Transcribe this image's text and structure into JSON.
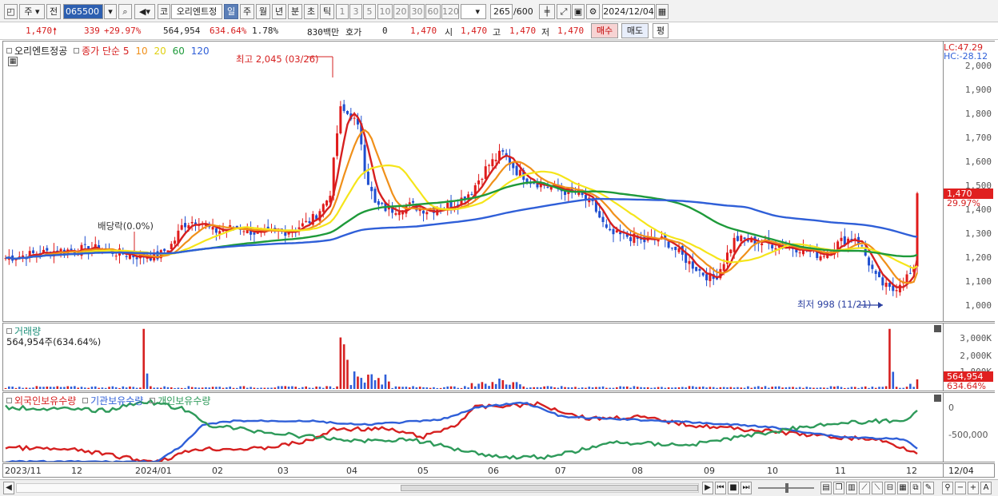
{
  "toolbar": {
    "period_type": "주",
    "prev_label": "전",
    "code": "065500",
    "market_label": "코",
    "stock_name": "오리엔트정",
    "timeframes": [
      "일",
      "주",
      "월",
      "년",
      "분",
      "초",
      "틱"
    ],
    "selected_timeframe": "일",
    "intervals": [
      "1",
      "3",
      "5",
      "10",
      "20",
      "30",
      "60",
      "120"
    ],
    "count": "265",
    "count_max": "/600",
    "date": "2024/12/04"
  },
  "quote": {
    "price": "1,470",
    "change": "339",
    "change_pct": "+29.97%",
    "volume": "564,954",
    "volume_pct": "634.64%",
    "turnover_pct": "1.78%",
    "amount": "830백만",
    "bid_label": "호가",
    "bid_value": "0",
    "bid_price": "1,470",
    "open_label": "시",
    "open": "1,470",
    "high_label": "고",
    "high": "1,470",
    "low_label": "저",
    "low": "1,470",
    "buy_label": "매수",
    "sell_label": "매도",
    "eval_label": "평"
  },
  "price_panel": {
    "name": "오리엔트정공",
    "ma_label": "종가 단순",
    "ma_periods": [
      "5",
      "10",
      "20",
      "60",
      "120"
    ],
    "ma_colors": [
      "#d62020",
      "#f0901a",
      "#f2e21a",
      "#1e9a3a",
      "#2f5fd8"
    ],
    "lc": "LC:47.29",
    "hc": "HC:-28.12",
    "high_annotation": "최고 2,045 (03/26)",
    "low_annotation": "최저 998 (11/21)",
    "dividend_annotation": "배당락(0.0%)",
    "current_price": "1,470",
    "current_pct": "29.97%",
    "y_ticks": [
      "2,000",
      "1,900",
      "1,800",
      "1,700",
      "1,600",
      "1,500",
      "1,400",
      "1,300",
      "1,200",
      "1,100",
      "1,000"
    ]
  },
  "volume_panel": {
    "title": "거래량",
    "current": "564,954주(634.64%)",
    "y_ticks": [
      "3,000K",
      "2,000K",
      "1,000K"
    ],
    "current_value": "564,954",
    "current_pct": "634.64%"
  },
  "holding_panel": {
    "legend": [
      "외국인보유수량",
      "기관보유수량",
      "개인보유수량"
    ],
    "colors": [
      "#d62020",
      "#2f5fd8",
      "#2e9a5a"
    ],
    "y_ticks": [
      "0",
      "-500,000"
    ]
  },
  "x_axis": [
    "2023/11",
    "12",
    "2024/01",
    "02",
    "03",
    "04",
    "05",
    "06",
    "07",
    "08",
    "09",
    "10",
    "11",
    "12"
  ],
  "x_axis_right": "12/04"
}
